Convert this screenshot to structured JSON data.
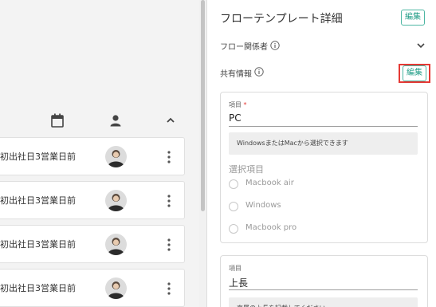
{
  "tasks": [
    {
      "title": "初出社日3営業日前"
    },
    {
      "title": "初出社日3営業日前"
    },
    {
      "title": "初出社日3営業日前"
    },
    {
      "title": "初出社日3営業日前"
    }
  ],
  "panel": {
    "title": "フローテンプレート詳細",
    "edit_label": "編集",
    "flow_members_label": "フロー関係者",
    "shared_info_label": "共有情報",
    "shared_edit_label": "編集"
  },
  "form": {
    "field1": {
      "label": "項目",
      "required_mark": "*",
      "value": "PC",
      "help": "WindowsまたはMacから選択できます",
      "options_label": "選択項目",
      "options": [
        "Macbook air",
        "Windows",
        "Macbook pro"
      ]
    },
    "field2": {
      "label": "項目",
      "value": "上長",
      "help": "直属の上長を記載してください"
    }
  },
  "colors": {
    "accent": "#1f9c86",
    "highlight": "#e53935"
  }
}
